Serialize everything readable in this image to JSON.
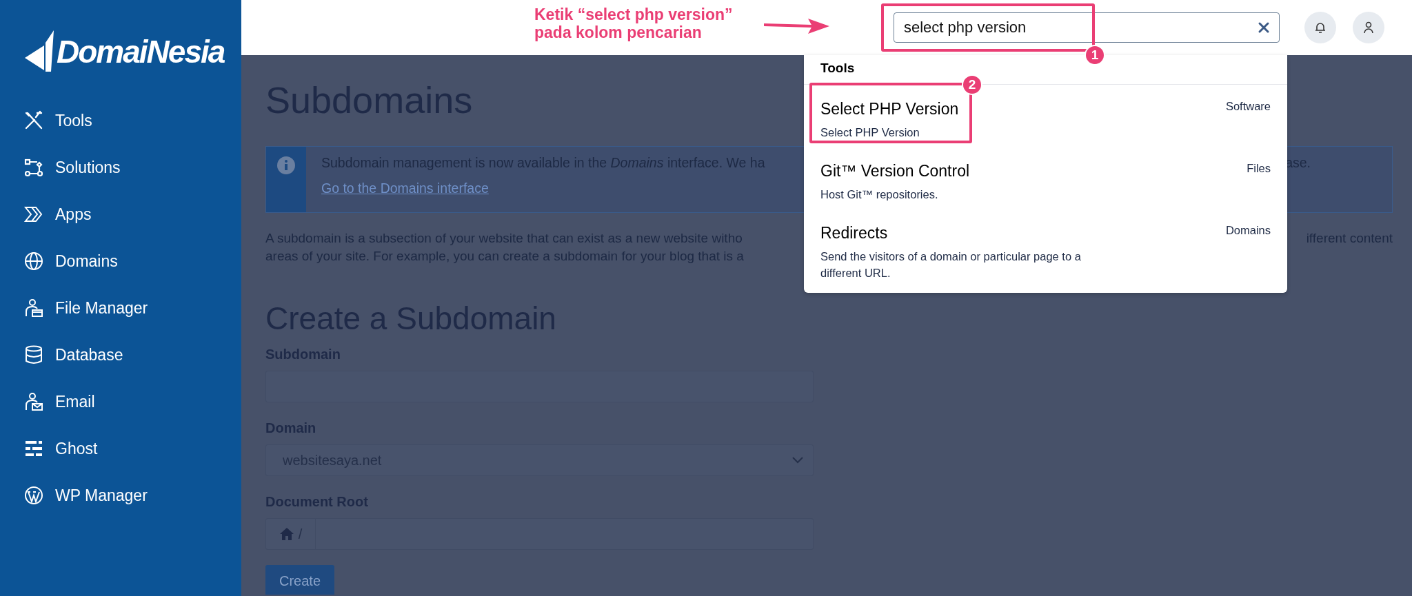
{
  "sidebar": {
    "logo": "DomaiNesia",
    "items": [
      {
        "label": "Tools"
      },
      {
        "label": "Solutions"
      },
      {
        "label": "Apps"
      },
      {
        "label": "Domains"
      },
      {
        "label": "File Manager"
      },
      {
        "label": "Database"
      },
      {
        "label": "Email"
      },
      {
        "label": "Ghost"
      },
      {
        "label": "WP Manager"
      }
    ]
  },
  "annotation": {
    "lines": [
      "Ketik “select php version”",
      "pada kolom pencarian"
    ]
  },
  "topbar": {
    "search": {
      "value": "select php version",
      "callout": "1"
    }
  },
  "search_results": {
    "section": "Tools",
    "results": [
      {
        "title": "Select PHP Version",
        "description": "Select PHP Version",
        "category": "Software",
        "callout": "2"
      },
      {
        "title": "Git™ Version Control",
        "description": "Host Git™ repositories.",
        "category": "Files"
      },
      {
        "title": "Redirects",
        "description": "Send the visitors of a domain or particular page to a different URL.",
        "category": "Domains"
      }
    ]
  },
  "page": {
    "title": "Subdomains",
    "notice": {
      "text": "Subdomain management is now available in the *Domains* interface. We ha",
      "text_end": "ase.",
      "link": "Go to the Domains interface"
    },
    "intro": {
      "lines": [
        "A subdomain is a subsection of your website that can exist as a new website witho",
        "areas of your site. For example, you can create a subdomain for your blog that is a"
      ],
      "line_end": "ifferent content"
    },
    "form": {
      "title": "Create a Subdomain",
      "fields": [
        {
          "kind": "text",
          "label": "Subdomain"
        },
        {
          "kind": "select",
          "label": "Domain",
          "value": "websitesaya.net"
        },
        {
          "kind": "path",
          "label": "Document Root",
          "prefix": "/"
        }
      ],
      "submit": "Create"
    }
  }
}
